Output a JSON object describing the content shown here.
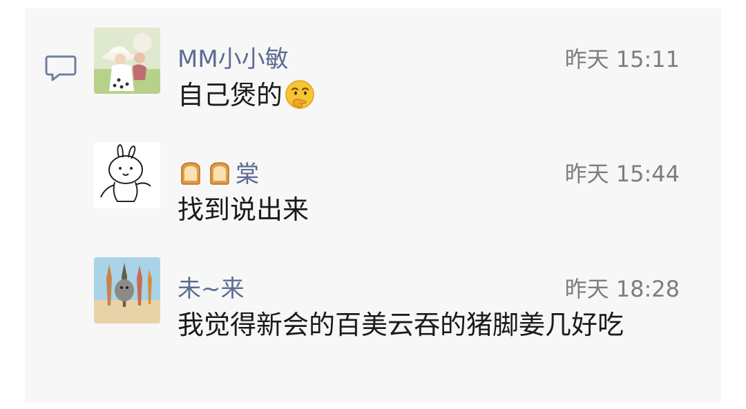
{
  "comments": [
    {
      "nickname": "MM小小敏",
      "time": "昨天 15:11",
      "text": "自己煲的",
      "emoji": "thinking-face-icon"
    },
    {
      "nickname_icons": [
        "bread-icon",
        "bread-icon"
      ],
      "nickname": "棠",
      "time": "昨天 15:44",
      "text": "找到说出来"
    },
    {
      "nickname": "未~来",
      "time": "昨天 18:28",
      "text": "我觉得新会的百美云吞的猪脚姜几好吃"
    }
  ],
  "icons": {
    "comment_marker": "comment-bubble-icon"
  },
  "colors": {
    "nickname": "#5b6c93",
    "time": "#7d7d7d",
    "background": "#f7f7f7"
  }
}
